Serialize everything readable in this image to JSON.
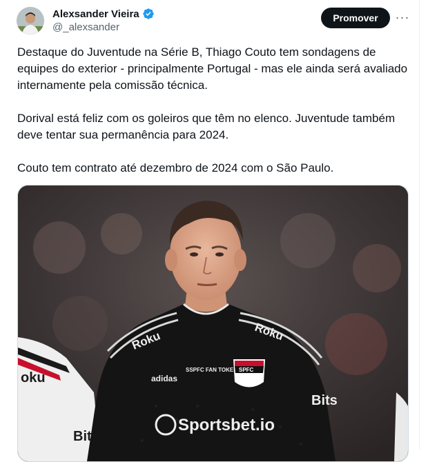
{
  "author": {
    "display_name": "Alexsander Vieira",
    "handle": "@_alexsander",
    "verified_icon": "verified-badge-icon",
    "badge_color": "#1d9bf0"
  },
  "actions": {
    "promote_label": "Promover",
    "more_icon": "more-options-icon",
    "more_glyph": "···"
  },
  "tweet": {
    "paragraphs": [
      "Destaque do Juventude na Série B, Thiago Couto tem sondagens de equipes do exterior - principalmente Portugal - mas ele ainda será avaliado internamente pela comissão técnica.",
      "Dorival está feliz com os goleiros que têm no elenco. Juventude também deve tentar sua permanência para 2024.",
      "Couto tem contrato até dezembro de 2024 com o São Paulo."
    ]
  },
  "media": {
    "jersey_texts": {
      "sponsor_chest": "Roku",
      "sponsor_shoulder": "Roku",
      "fan_token": "SSPFC FAN TOKEN",
      "brand": "adidas",
      "crest": "SPFC",
      "sponsor_main": "Sportsbet.io",
      "sleeve": "Bits",
      "left_player_chest": "oku",
      "left_player_sleeve": "Bit"
    }
  }
}
